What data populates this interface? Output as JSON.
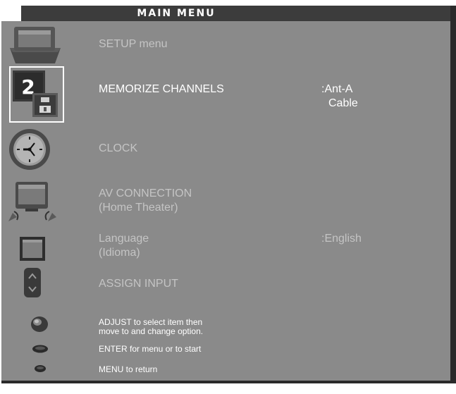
{
  "header": {
    "title": "MAIN MENU"
  },
  "menu": {
    "items": [
      {
        "label": "SETUP menu",
        "icon": "tv-setup-icon"
      },
      {
        "label": "MEMORIZE CHANNELS",
        "icon": "memorize-channel-icon",
        "selected": true,
        "options": [
          ":Ant-A",
          "Cable"
        ],
        "icon_digit": "2"
      },
      {
        "label": "CLOCK",
        "icon": "clock-icon"
      },
      {
        "label": "AV CONNECTION",
        "sublabel": "(Home Theater)",
        "icon": "av-connection-icon"
      },
      {
        "label": "Language",
        "sublabel": "(Idioma)",
        "option": ":English",
        "icon": "language-icon"
      },
      {
        "label": "ASSIGN INPUT",
        "icon": "assign-input-icon"
      }
    ]
  },
  "help": {
    "adjust_line1": "ADJUST to select item then",
    "adjust_line2": "move to and change option.",
    "enter": "ENTER for menu or to start",
    "menu_return": "MENU to return"
  },
  "colors": {
    "panel": "#8a8a8a",
    "header": "#3c3c3c",
    "active_text": "#ffffff",
    "inactive_text": "#c4c4c4"
  }
}
